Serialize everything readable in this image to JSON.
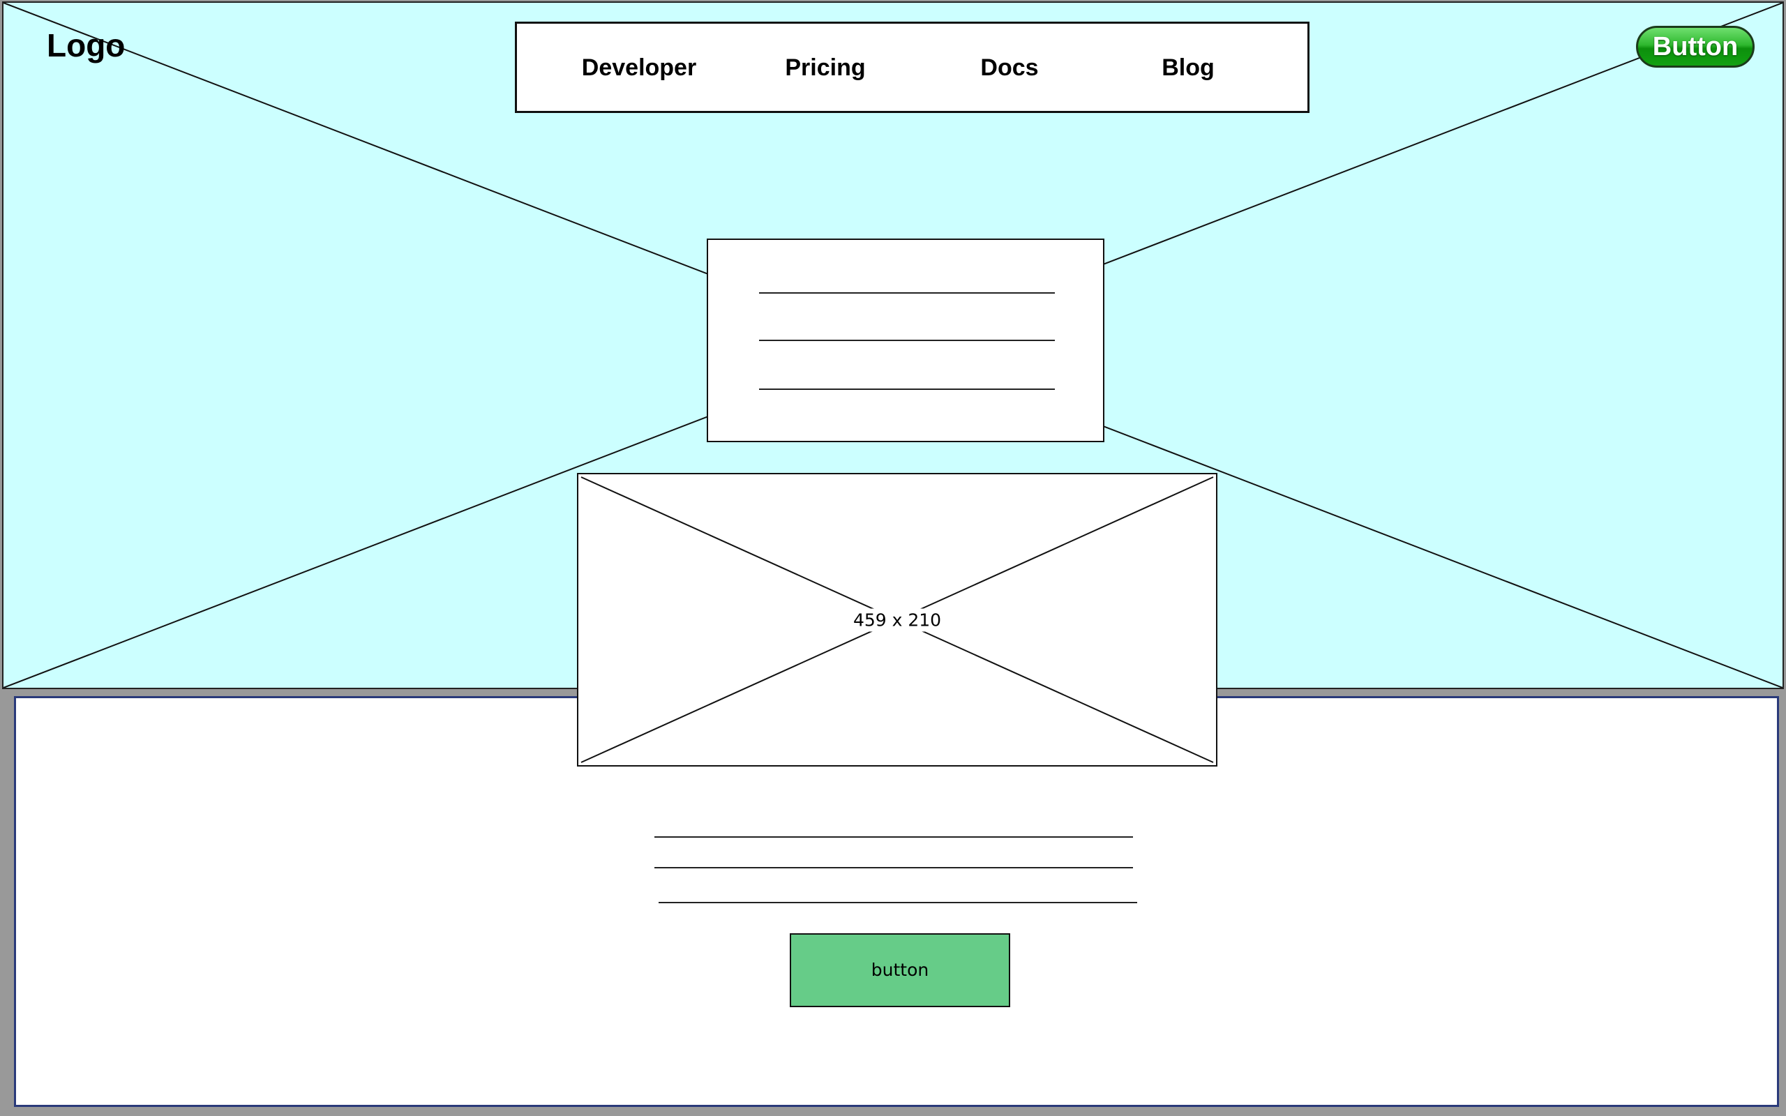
{
  "header": {
    "logo": "Logo",
    "nav": [
      "Developer",
      "Pricing",
      "Docs",
      "Blog"
    ],
    "button_label": "Button"
  },
  "image_placeholder": {
    "label": "459 x 210"
  },
  "cta": {
    "label": "button"
  },
  "colors": {
    "hero_background": "#ccffff",
    "page_background": "#999999",
    "cta_background": "#66cc88",
    "top_button_green": "#2fb82f",
    "lower_border": "#2a3a7a"
  }
}
